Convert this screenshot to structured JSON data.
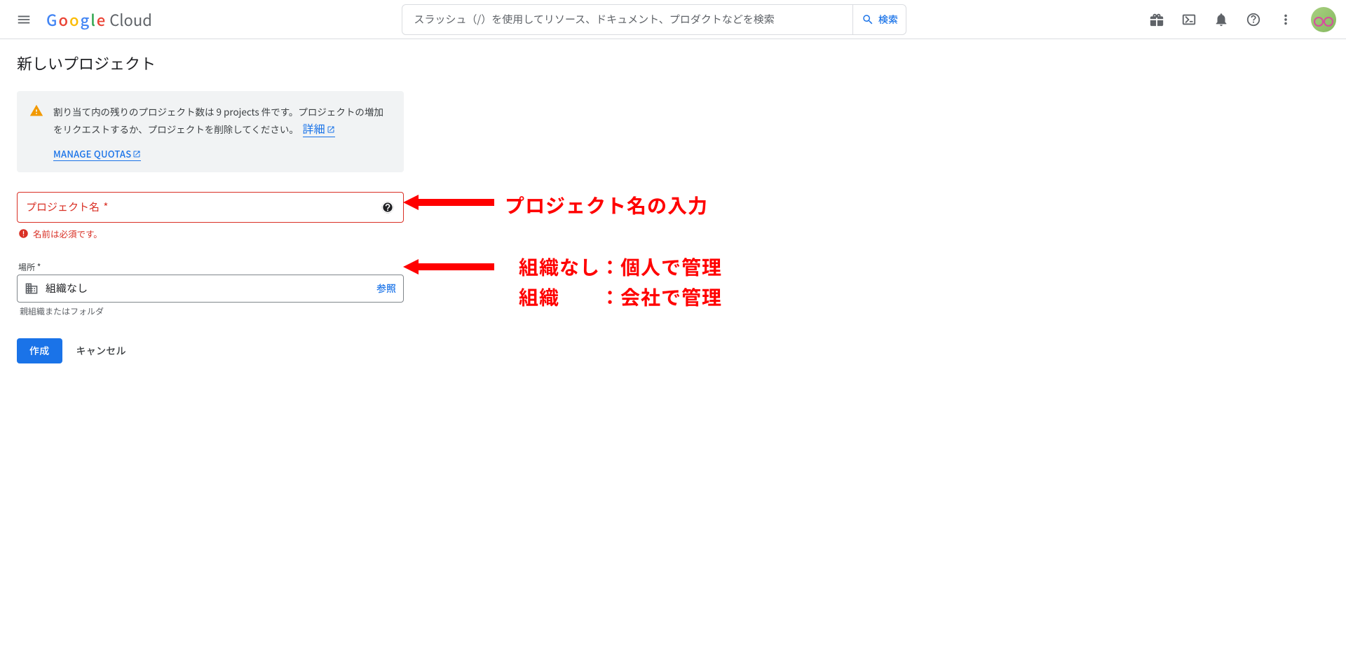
{
  "header": {
    "logo_cloud": "Cloud",
    "search_placeholder": "スラッシュ（/）を使用してリソース、ドキュメント、プロダクトなどを検索",
    "search_button": "検索"
  },
  "page": {
    "title": "新しいプロジェクト"
  },
  "info": {
    "text": "割り当て内の残りのプロジェクト数は 9 projects 件です。プロジェクトの増加をリクエストするか、プロジェクトを削除してください。",
    "learn_more": "詳細",
    "manage_quotas": "MANAGE QUOTAS"
  },
  "project_name": {
    "label": "プロジェクト名",
    "value": "",
    "error": "名前は必須です。"
  },
  "location": {
    "label": "場所",
    "value": "組織なし",
    "browse": "参照",
    "hint": "親組織またはフォルダ"
  },
  "buttons": {
    "create": "作成",
    "cancel": "キャンセル"
  },
  "annotations": {
    "a1": "プロジェクト名の入力",
    "a2_l1": "組織なし：個人で管理",
    "a2_l2": "組織　　：会社で管理"
  }
}
